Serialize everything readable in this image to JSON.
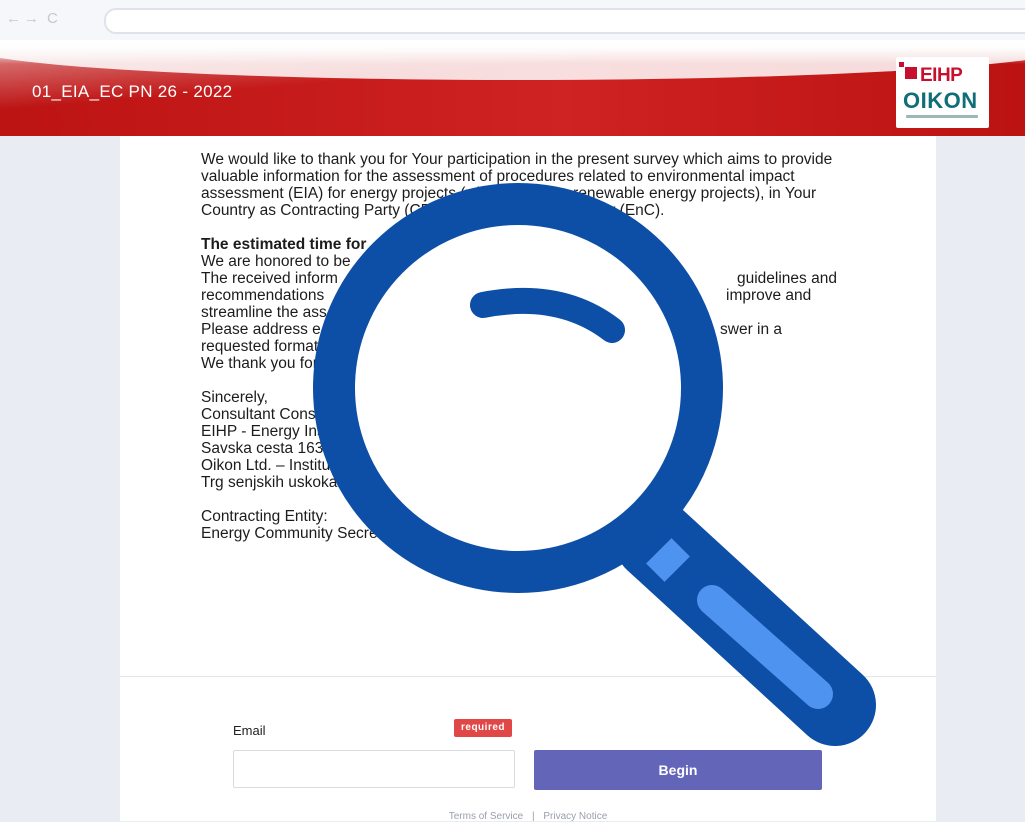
{
  "browser": {
    "back_icon": "back-arrow-icon",
    "forward_icon": "forward-arrow-icon",
    "reload_icon": "reload-icon",
    "back_glyph": "←",
    "forward_glyph": "→",
    "reload_glyph": "C"
  },
  "banner": {
    "title": "01_EIA_EC PN 26 - 2022",
    "logo_top": "EIHP",
    "logo_bottom": "OIKON",
    "color": "#c41a1a"
  },
  "intro": {
    "paragraph1": "We would like to thank you for Your participation in the present survey which aims to provide valuable information for the assessment of procedures related to environmental impact assessment (EIA) for energy projects (with a focus on renewable energy projects), in Your Country as Contracting Party (CP) of the Energy Community (EnC).",
    "estimated_time": "The estimated time for",
    "line_honored": "We are honored to be",
    "line_received": "The received inform",
    "line_received_end": "guidelines and",
    "line_recommendations": "recommendations",
    "line_recommendations_end": "improve and",
    "line_streamline": "streamline the ass",
    "line_address": "Please address e",
    "line_address_end": "swer in a",
    "line_requested": "requested format",
    "line_thank": "We thank you for",
    "sincerely": "Sincerely,",
    "consultant": "Consultant Consor",
    "eihp": "EIHP - Energy Instit",
    "savska": "Savska cesta 163 HR",
    "oikon": "Oikon Ltd. – Institute of",
    "trg": "Trg senjskih uskoka 1-2 HR",
    "contracting_label": "Contracting Entity:",
    "contracting_value": "Energy Community Secretariat Am Hof 4, 5th floor A-1010 V"
  },
  "form": {
    "email_label": "Email",
    "required_badge": "required",
    "email_value": "",
    "email_placeholder": "",
    "begin_label": "Begin",
    "accent_color": "#6366b8",
    "badge_color": "#e04848"
  },
  "footer": {
    "terms": "Terms of Service",
    "separator": "|",
    "privacy": "Privacy Notice"
  },
  "overlay": {
    "icon": "magnifying-glass-icon",
    "color": "#0d4fa6"
  }
}
